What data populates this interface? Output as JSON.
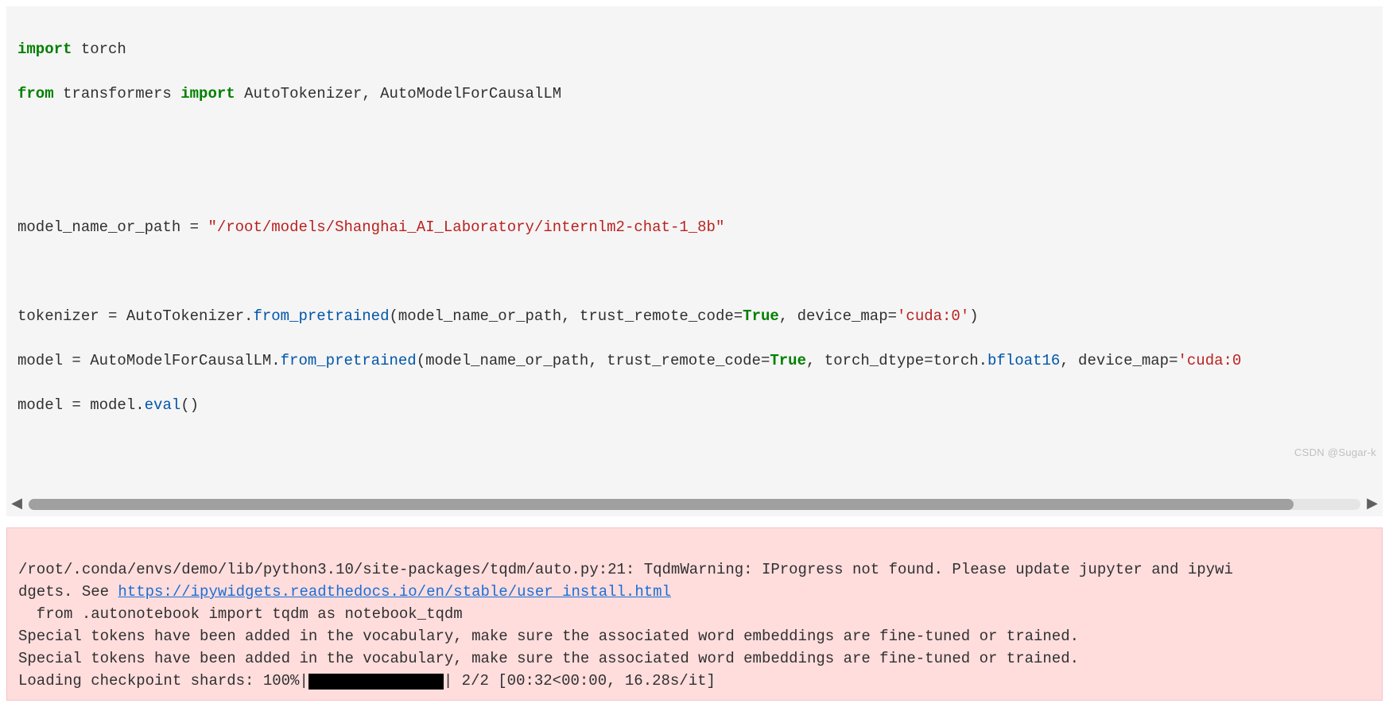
{
  "code": {
    "l1_kw1": "import",
    "l1_rest": " torch",
    "l2_kw1": "from",
    "l2_mid": " transformers ",
    "l2_kw2": "import",
    "l2_rest": " AutoTokenizer, AutoModelForCausalLM",
    "l4_pre": "model_name_or_path = ",
    "l4_str": "\"/root/models/Shanghai_AI_Laboratory/internlm2-chat-1_8b\"",
    "l6_pre": "tokenizer = AutoTokenizer.",
    "l6_fn": "from_pretrained",
    "l6_arg1": "(model_name_or_path, trust_remote_code=",
    "l6_true": "True",
    "l6_arg2": ", device_map=",
    "l6_str": "'cuda:0'",
    "l6_end": ")",
    "l7_pre": "model = AutoModelForCausalLM.",
    "l7_fn": "from_pretrained",
    "l7_arg1": "(model_name_or_path, trust_remote_code=",
    "l7_true": "True",
    "l7_arg2": ", torch_dtype=torch.",
    "l7_bf": "bfloat16",
    "l7_arg3": ", device_map=",
    "l7_str": "'cuda:0",
    "l8_pre": "model = model.",
    "l8_fn": "eval",
    "l8_end": "()"
  },
  "output": {
    "warn1a": "/root/.conda/envs/demo/lib/python3.10/site-packages/tqdm/auto.py:21: TqdmWarning: IProgress not found. Please update jupyter and ipywi",
    "warn1b_pre": "dgets. See ",
    "warn1b_link": "https://ipywidgets.readthedocs.io/en/stable/user_install.html",
    "warn2": "  from .autonotebook import tqdm as notebook_tqdm",
    "warn3": "Special tokens have been added in the vocabulary, make sure the associated word embeddings are fine-tuned or trained.",
    "warn4": "Special tokens have been added in the vocabulary, make sure the associated word embeddings are fine-tuned or trained.",
    "load_pre": "Loading checkpoint shards: 100%|",
    "load_post": "| 2/2 [00:32<00:00, 16.28s/it]"
  },
  "watermark": "CSDN @Sugar-k"
}
